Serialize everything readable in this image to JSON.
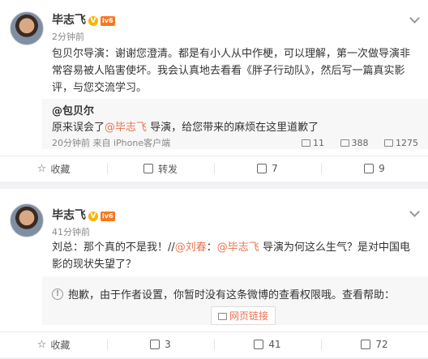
{
  "post1": {
    "author": "毕志飞",
    "time": "2分钟前",
    "content_parts": [
      "包贝尔导演：谢谢您澄清。都是有小人从中作梗，可以理解，第一次做导演非常容易被人陷害使坏。我会认真地去看看《胖子行动队》，然后写一篇真实影评，与您交流学习。"
    ],
    "quote": {
      "author": "@包贝尔",
      "text_a": "原来误会了",
      "mention": "@毕志飞",
      "text_b": " 导演，给您带来的麻烦在这里道歉了",
      "meta": "20分钟前 来自 iPhone客户端",
      "reposts": "11",
      "comments": "388",
      "likes": "1275"
    },
    "actions": {
      "fav": "收藏",
      "repost": "转发",
      "comments": "7",
      "likes": "9"
    }
  },
  "post2": {
    "author": "毕志飞",
    "time": "41分钟前",
    "text_a": "刘总：那个真的不是我！//",
    "mention1": "@刘春",
    "text_b": "：",
    "mention2": "@毕志飞",
    "text_c": " 导演为何这么生气？是对中国电影的现状失望了？",
    "notice": "抱歉，由于作者设置，你暂时没有这条微博的查看权限哦。查看帮助：",
    "notice_link": "网页链接",
    "actions": {
      "fav": "收藏",
      "reposts": "3",
      "comments": "41",
      "likes": "72"
    }
  },
  "badges": {
    "v": "V",
    "level": "lv6"
  }
}
